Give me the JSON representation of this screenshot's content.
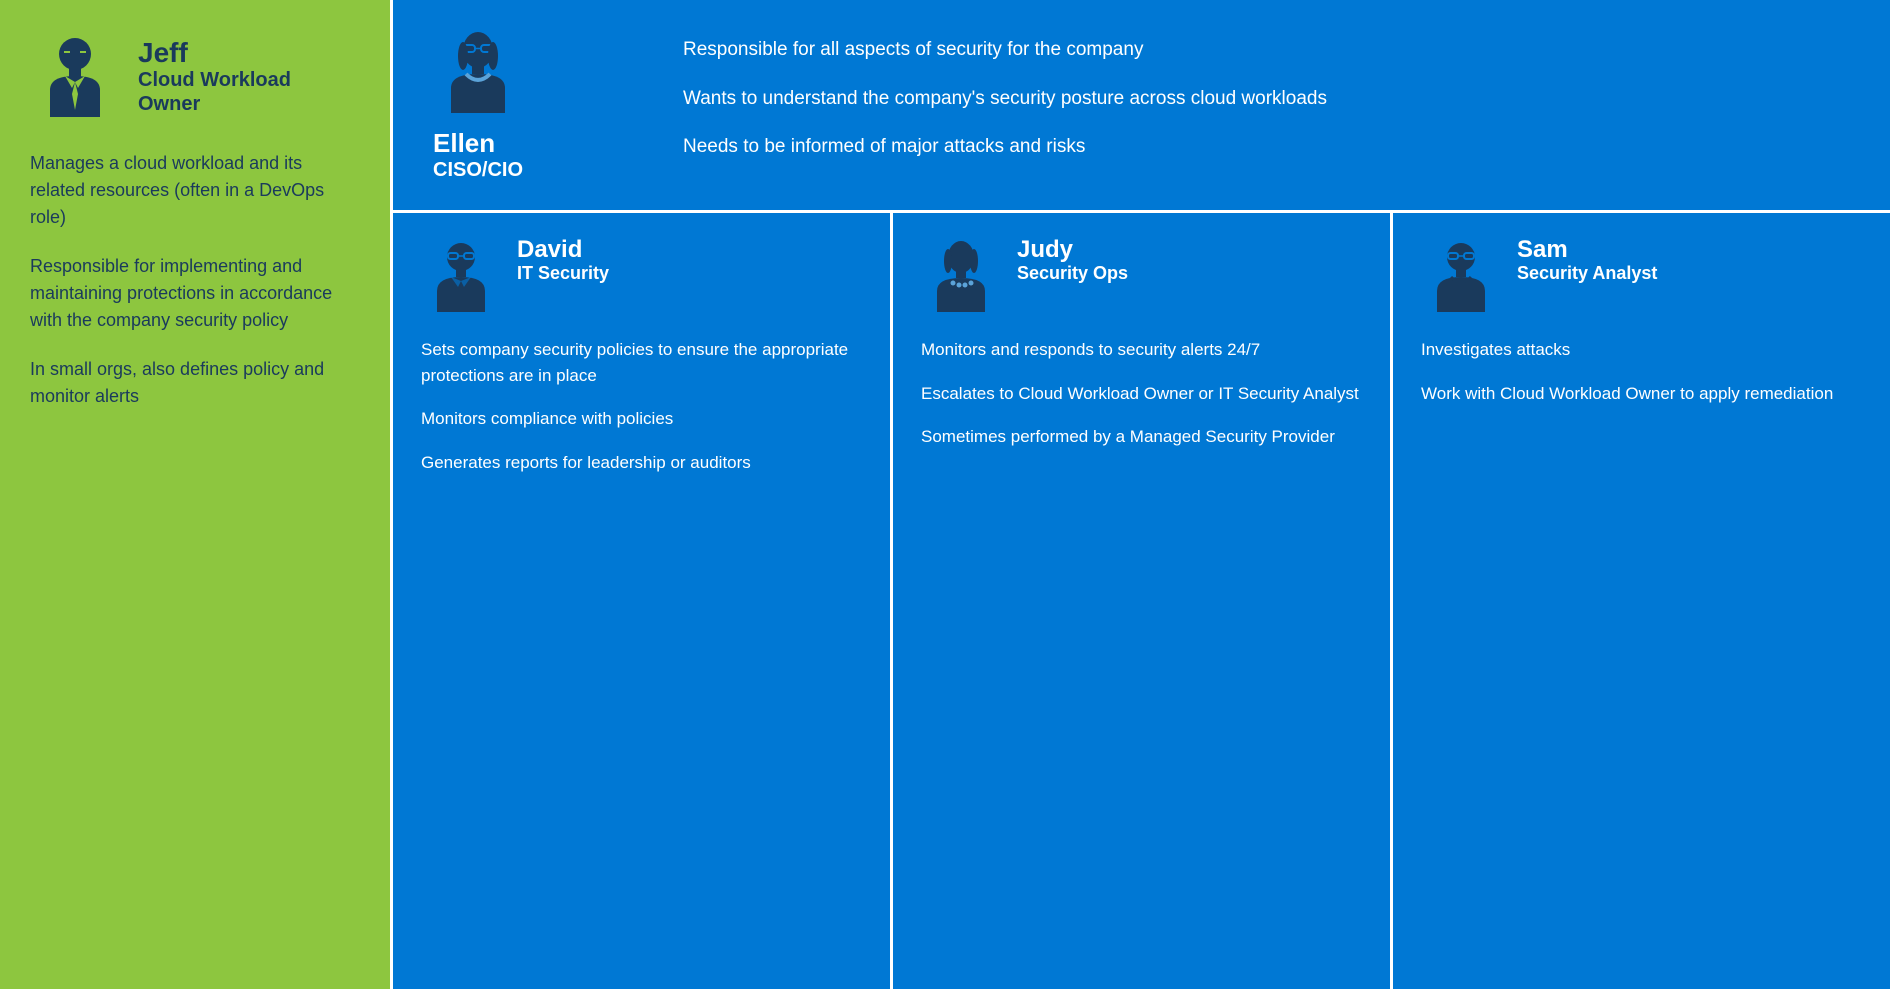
{
  "left": {
    "name": "Jeff",
    "title_line1": "Cloud Workload",
    "title_line2": "Owner",
    "desc1": "Manages a cloud workload and its related resources (often in a DevOps role)",
    "desc2": "Responsible for implementing and maintaining protections in accordance with the company security policy",
    "desc3": "In small orgs, also defines policy and monitor alerts"
  },
  "ellen": {
    "name": "Ellen",
    "role": "CISO/CIO",
    "point1": "Responsible for all aspects of security for the company",
    "point2": "Wants to understand the company's security posture across cloud workloads",
    "point3": "Needs to be informed of major attacks and risks"
  },
  "david": {
    "name": "David",
    "role": "IT Security",
    "point1": "Sets company security policies to ensure the appropriate protections are in place",
    "point2": "Monitors compliance with policies",
    "point3": "Generates reports for leadership or auditors"
  },
  "judy": {
    "name": "Judy",
    "role": "Security Ops",
    "point1": "Monitors and responds to security alerts 24/7",
    "point2": "Escalates to Cloud Workload Owner or IT Security Analyst",
    "point3": "Sometimes performed by a Managed Security Provider"
  },
  "sam": {
    "name": "Sam",
    "role": "Security Analyst",
    "point1": "Investigates attacks",
    "point2": "Work with Cloud Workload Owner to apply remediation"
  },
  "colors": {
    "green": "#8DC63F",
    "blue": "#0078D4",
    "dark_navy": "#1a3a5c",
    "white": "#ffffff"
  }
}
